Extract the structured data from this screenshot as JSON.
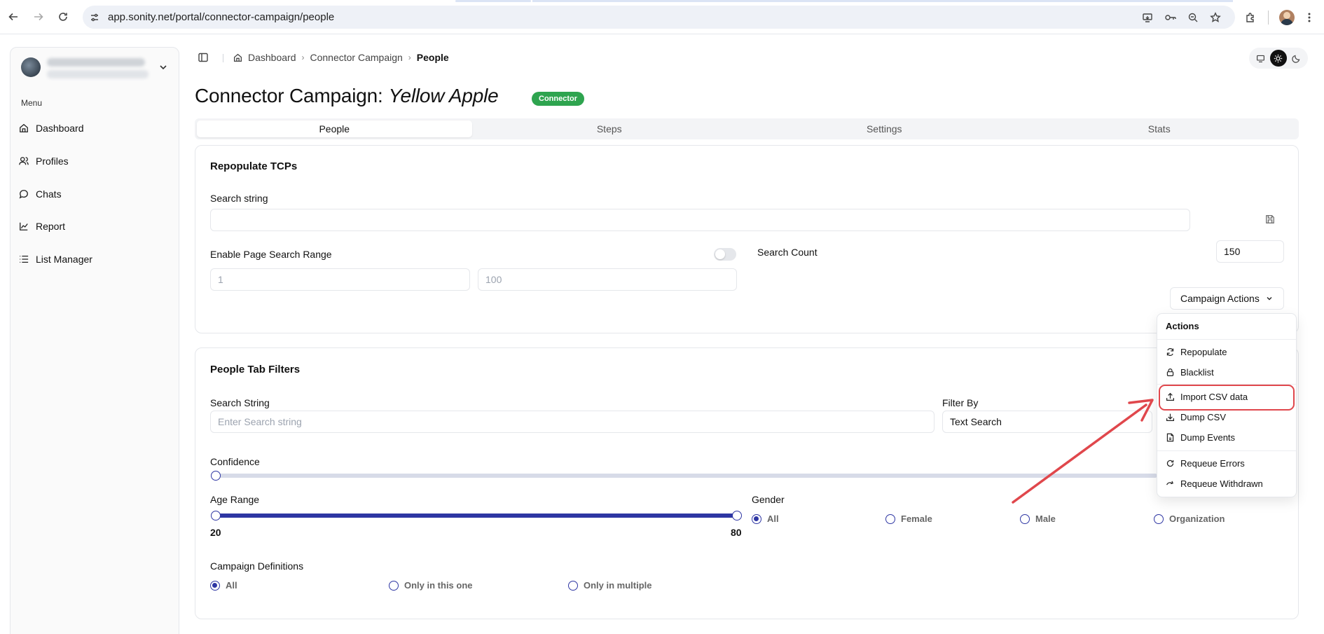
{
  "browser": {
    "url": "app.sonity.net/portal/connector-campaign/people"
  },
  "sidebar": {
    "menu_label": "Menu",
    "items": [
      {
        "label": "Dashboard",
        "icon": "home-icon"
      },
      {
        "label": "Profiles",
        "icon": "users-icon"
      },
      {
        "label": "Chats",
        "icon": "chat-icon"
      },
      {
        "label": "Report",
        "icon": "chart-icon"
      },
      {
        "label": "List Manager",
        "icon": "list-icon"
      }
    ]
  },
  "breadcrumb": {
    "items": [
      "Dashboard",
      "Connector Campaign",
      "People"
    ]
  },
  "page": {
    "title_prefix": "Connector Campaign:",
    "title_name": "Yellow Apple",
    "badge": "Connector",
    "badge_color": "#2ea44f"
  },
  "tabs": [
    "People",
    "Steps",
    "Settings",
    "Stats"
  ],
  "repopulate": {
    "title": "Repopulate TCPs",
    "search_label": "Search string",
    "search_value": "",
    "enable_range_label": "Enable Page Search Range",
    "range_from_placeholder": "1",
    "range_to_placeholder": "100",
    "search_count_label": "Search Count",
    "search_count_value": "150",
    "actions_button": "Campaign Actions"
  },
  "filters": {
    "title": "People Tab Filters",
    "search_label": "Search String",
    "search_placeholder": "Enter Search string",
    "filter_by_label": "Filter By",
    "filter_by_value": "Text Search",
    "confidence_label": "Confidence",
    "age_label": "Age Range",
    "age_min": "20",
    "age_max": "80",
    "gender_label": "Gender",
    "gender_options": [
      "All",
      "Female",
      "Male",
      "Organization"
    ],
    "gender_selected": "All",
    "definitions_label": "Campaign Definitions",
    "definition_options": [
      "All",
      "Only in this one",
      "Only in multiple"
    ],
    "definition_selected": "All"
  },
  "actions_menu": {
    "heading": "Actions",
    "items": [
      "Repopulate",
      "Blacklist",
      "Import CSV data",
      "Dump CSV",
      "Dump Events",
      "Requeue Errors",
      "Requeue Withdrawn"
    ],
    "highlighted": "Import CSV data",
    "highlight_color": "#e0474c"
  },
  "colors": {
    "accent": "#2e36a3"
  }
}
